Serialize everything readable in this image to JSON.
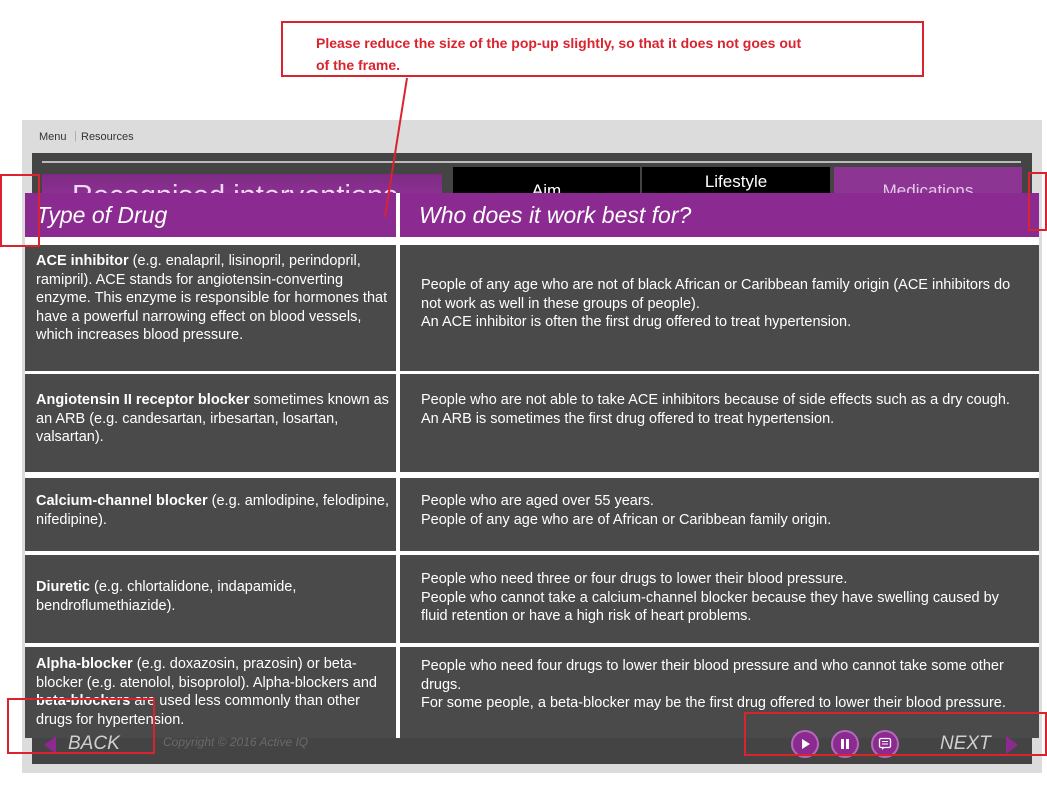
{
  "annotation": {
    "text_line1": "Please reduce the size of the pop-up slightly, so that it does not goes out",
    "text_line2": "of the frame."
  },
  "topbar": {
    "menu": "Menu",
    "separator": "|",
    "resources": "Resources"
  },
  "slide": {
    "heading": "Recognised interventions",
    "tabs": {
      "aim": "Aim",
      "lifestyle": "Lifestyle",
      "medications": "Medications"
    }
  },
  "table": {
    "col1_header": "Type of Drug",
    "col2_header": "Who does it work best for?",
    "rows": [
      {
        "drug_bold": "ACE inhibitor",
        "drug_text": " (e.g. enalapril, lisinopril, perindopril, ramipril). ACE stands for angiotensin-converting enzyme. This enzyme is responsible for hormones that have a powerful narrowing effect on blood vessels, which increases blood pressure.",
        "who_lines": [
          "People of any age who are not of black African or Caribbean family origin (ACE inhibitors do not work as well in these groups of people).",
          "An ACE inhibitor is often the first drug offered to treat hypertension."
        ]
      },
      {
        "drug_bold": "Angiotensin II receptor blocker",
        "drug_text": " sometimes known as an ARB (e.g. candesartan, irbesartan, losartan, valsartan).",
        "who_lines": [
          "People who are not able to take ACE inhibitors because of side effects such as a dry cough. An ARB is sometimes the first drug offered to treat hypertension."
        ]
      },
      {
        "drug_bold": "Calcium-channel blocker",
        "drug_text": " (e.g. amlodipine, felodipine, nifedipine).",
        "who_lines": [
          "People who are aged over 55 years.",
          "People of any age who are of African or Caribbean family origin."
        ]
      },
      {
        "drug_bold": "Diuretic",
        "drug_text": " (e.g. chlortalidone, indapamide, bendroflumethiazide).",
        "who_lines": [
          "People who need three or four drugs to lower their blood pressure.",
          "People who cannot take a calcium-channel blocker because they have swelling caused by fluid retention or have a high risk of heart problems."
        ]
      },
      {
        "drug_bold": "Alpha-blocker",
        "drug_text": " (e.g. doxazosin, prazosin) or beta-blocker (e.g. atenolol, bisoprolol). Alpha-blockers and ",
        "drug_bold2": "beta-blockers",
        "drug_text2": " are used less commonly than other drugs for hypertension.",
        "who_lines": [
          "People who need four drugs to lower their blood pressure and who cannot take some other drugs.",
          "For some people, a beta-blocker may be the first drug offered to lower their blood pressure."
        ]
      }
    ]
  },
  "footer": {
    "back": "BACK",
    "copyright": "Copyright © 2016 Active IQ",
    "next": "NEXT"
  },
  "colors": {
    "accent": "#8b2a90",
    "annotation": "#d9232e",
    "cell_bg": "#4a4a4a"
  }
}
